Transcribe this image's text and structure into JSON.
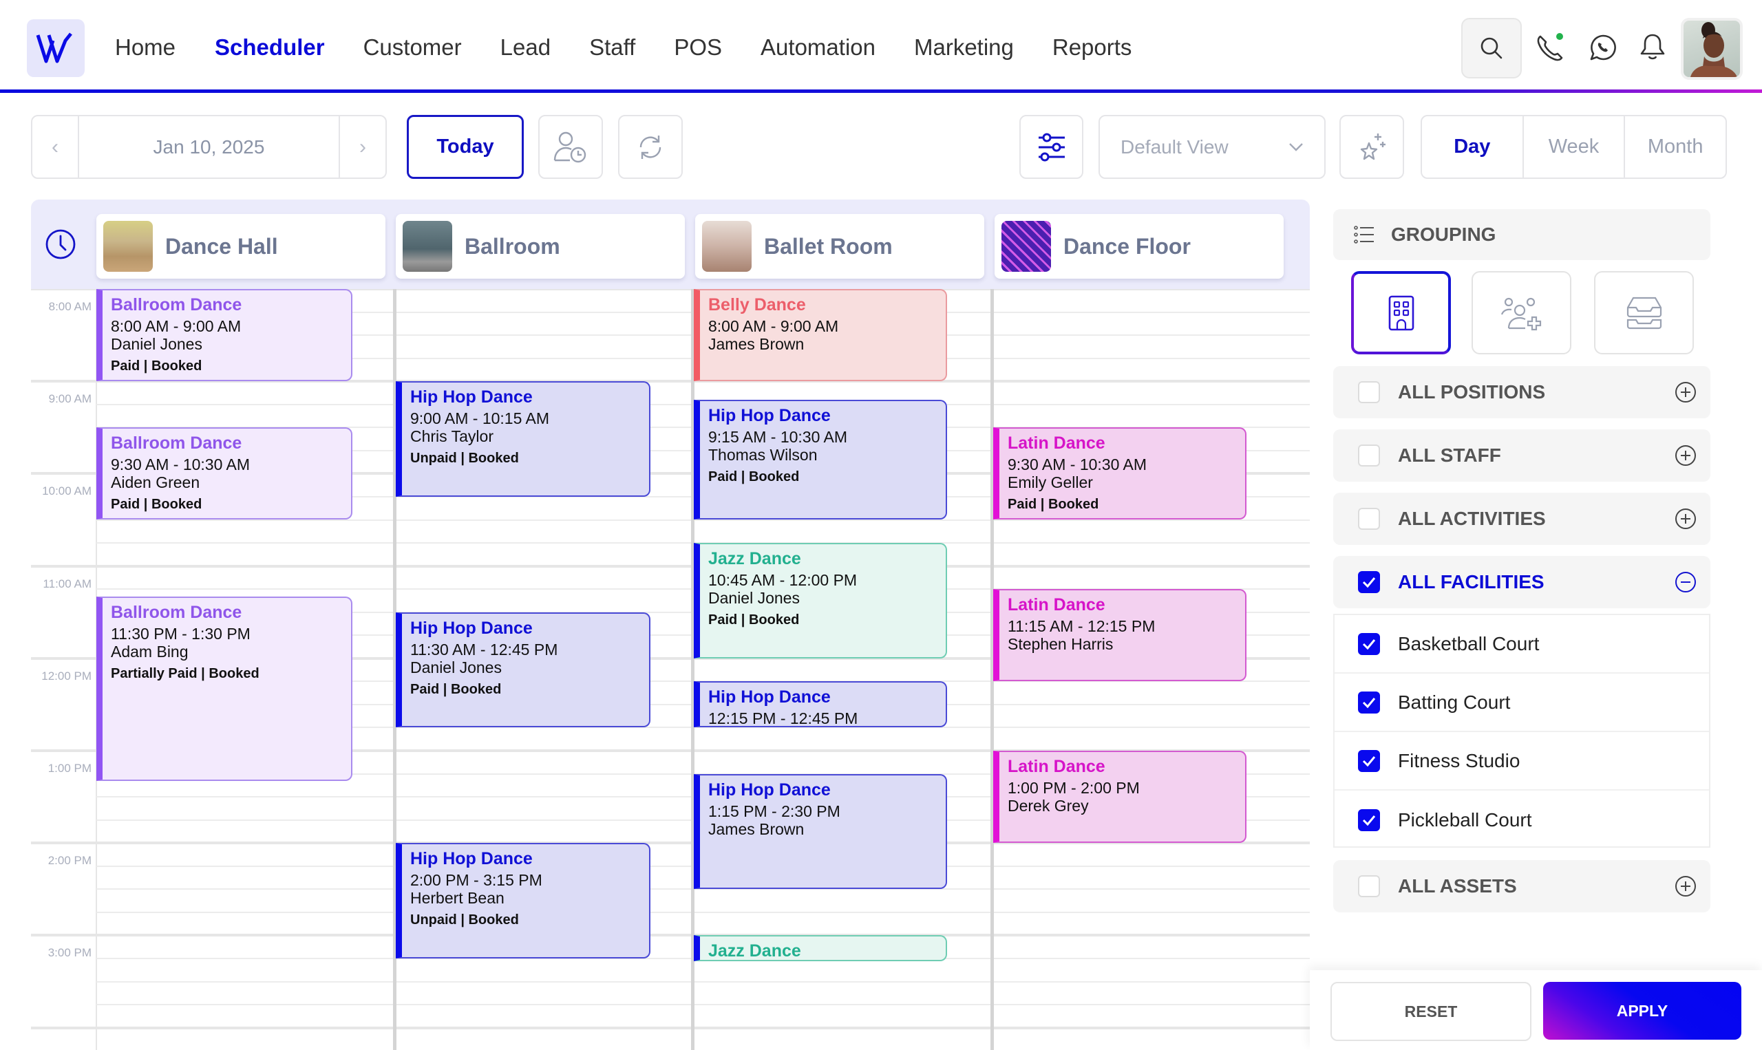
{
  "nav": {
    "logo_letter": "W",
    "items": [
      "Home",
      "Scheduler",
      "Customer",
      "Lead",
      "Staff",
      "POS",
      "Automation",
      "Marketing",
      "Reports"
    ],
    "active": "Scheduler",
    "icons": [
      "search-icon",
      "phone-icon",
      "whatsapp-icon",
      "bell-icon"
    ],
    "phone_status_dot_color": "#22b24c"
  },
  "toolbar": {
    "prev_label": "‹",
    "next_label": "›",
    "date": "Jan 10, 2025",
    "today_label": "Today",
    "view_select_value": "Default View",
    "view_modes": [
      "Day",
      "Week",
      "Month"
    ],
    "active_view": "Day"
  },
  "calendar": {
    "resources": [
      {
        "name": "Dance Hall"
      },
      {
        "name": "Ballroom"
      },
      {
        "name": "Ballet Room"
      },
      {
        "name": "Dance Floor"
      }
    ],
    "time_labels": [
      "8:00 AM",
      "9:00 AM",
      "10:00 AM",
      "11:00 AM",
      "12:00 PM",
      "1:00 PM",
      "2:00 PM",
      "3:00 PM"
    ],
    "events": [
      {
        "resource": 0,
        "type": "ballroom",
        "title": "Ballroom Dance",
        "time": "8:00 AM - 9:00 AM",
        "person": "Daniel Jones",
        "status": "Paid | Booked",
        "start": 8.0,
        "end": 9.0
      },
      {
        "resource": 0,
        "type": "ballroom",
        "title": "Ballroom Dance",
        "time": "9:30 AM - 10:30 AM",
        "person": "Aiden Green",
        "status": "Paid | Booked",
        "start": 9.5,
        "end": 10.5
      },
      {
        "resource": 0,
        "type": "ballroom",
        "title": "Ballroom Dance",
        "time": "11:30 PM - 1:30 PM",
        "person": "Adam Bing",
        "status": "Partially Paid | Booked",
        "start": 11.33,
        "end": 13.33
      },
      {
        "resource": 1,
        "type": "hiphop",
        "title": "Hip Hop Dance",
        "time": "9:00 AM - 10:15 AM",
        "person": "Chris Taylor",
        "status": "Unpaid | Booked",
        "start": 9.0,
        "end": 10.25
      },
      {
        "resource": 1,
        "type": "hiphop",
        "title": "Hip Hop Dance",
        "time": "11:30 AM - 12:45 PM",
        "person": "Daniel Jones",
        "status": "Paid | Booked",
        "start": 11.5,
        "end": 12.75
      },
      {
        "resource": 1,
        "type": "hiphop",
        "title": "Hip Hop Dance",
        "time": "2:00 PM - 3:15 PM",
        "person": "Herbert Bean",
        "status": "Unpaid | Booked",
        "start": 14.0,
        "end": 15.25
      },
      {
        "resource": 2,
        "type": "belly",
        "title": "Belly Dance",
        "time": "8:00 AM - 9:00 AM",
        "person": "James Brown",
        "status": "",
        "start": 8.0,
        "end": 9.0
      },
      {
        "resource": 2,
        "type": "hiphop",
        "title": "Hip Hop Dance",
        "time": "9:15 AM - 10:30 AM",
        "person": "Thomas Wilson",
        "status": "Paid | Booked",
        "start": 9.2,
        "end": 10.5
      },
      {
        "resource": 2,
        "type": "jazz",
        "title": "Jazz Dance",
        "time": "10:45 AM - 12:00 PM",
        "person": "Daniel Jones",
        "status": "Paid | Booked",
        "start": 10.75,
        "end": 12.0
      },
      {
        "resource": 2,
        "type": "hiphop",
        "title": "Hip Hop Dance",
        "time": "12:15 PM - 12:45 PM",
        "person": "",
        "status": "",
        "start": 12.25,
        "end": 12.75
      },
      {
        "resource": 2,
        "type": "hiphop",
        "title": "Hip Hop Dance",
        "time": "1:15 PM - 2:30 PM",
        "person": "James Brown",
        "status": "",
        "start": 13.25,
        "end": 14.5
      },
      {
        "resource": 2,
        "type": "jazz",
        "title": "Jazz Dance",
        "time": "",
        "person": "",
        "status": "",
        "start": 15.0,
        "end": 15.28
      },
      {
        "resource": 3,
        "type": "latin",
        "title": "Latin Dance",
        "time": "9:30 AM - 10:30 AM",
        "person": "Emily Geller",
        "status": "Paid | Booked",
        "start": 9.5,
        "end": 10.5
      },
      {
        "resource": 3,
        "type": "latin",
        "title": "Latin Dance",
        "time": "11:15 AM - 12:15 PM",
        "person": "Stephen Harris",
        "status": "",
        "start": 11.25,
        "end": 12.25
      },
      {
        "resource": 3,
        "type": "latin",
        "title": "Latin Dance",
        "time": "1:00 PM - 2:00 PM",
        "person": "Derek Grey",
        "status": "",
        "start": 13.0,
        "end": 14.0
      }
    ]
  },
  "panel": {
    "grouping_label": "GROUPING",
    "grouping_options": [
      "facility-grouping",
      "staff-grouping",
      "asset-grouping"
    ],
    "grouping_active": "facility-grouping",
    "sections": [
      {
        "label": "ALL POSITIONS",
        "checked": false,
        "expanded": false
      },
      {
        "label": "ALL STAFF",
        "checked": false,
        "expanded": false
      },
      {
        "label": "ALL ACTIVITIES",
        "checked": false,
        "expanded": false
      },
      {
        "label": "ALL FACILITIES",
        "checked": true,
        "expanded": true
      },
      {
        "label": "ALL ASSETS",
        "checked": false,
        "expanded": false
      }
    ],
    "facilities": [
      {
        "label": "Basketball Court",
        "checked": true
      },
      {
        "label": "Batting Court",
        "checked": true
      },
      {
        "label": "Fitness Studio",
        "checked": true
      },
      {
        "label": "Pickleball Court",
        "checked": true
      }
    ],
    "reset_label": "RESET",
    "apply_label": "APPLY"
  },
  "colors": {
    "brand": "#0b0bd8",
    "ballroom": "#9155f3",
    "hiphop": "#0b0bea",
    "belly": "#f25b64",
    "jazz": "#22b08f",
    "latin": "#e210d6"
  }
}
